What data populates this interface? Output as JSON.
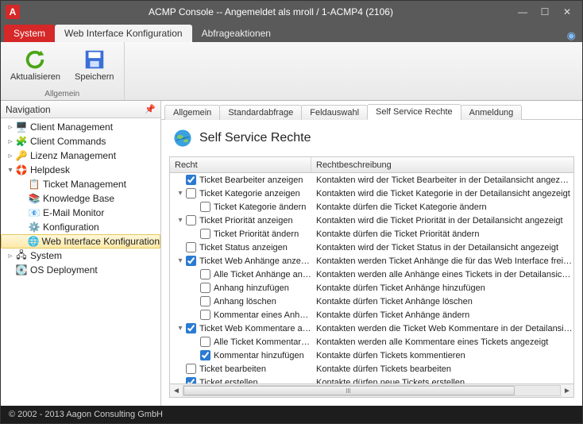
{
  "window": {
    "title": "ACMP Console -- Angemeldet als mroll / 1-ACMP4 (2106)"
  },
  "ribbon_tabs": {
    "system": "System",
    "active": "Web Interface Konfiguration",
    "third": "Abfrageaktionen"
  },
  "ribbon": {
    "refresh": "Aktualisieren",
    "save": "Speichern",
    "group": "Allgemein"
  },
  "nav": {
    "title": "Navigation",
    "items": {
      "client_mgmt": "Client Management",
      "client_cmds": "Client Commands",
      "lizenz_mgmt": "Lizenz Management",
      "helpdesk": "Helpdesk",
      "ticket_mgmt": "Ticket Management",
      "kb": "Knowledge Base",
      "email_mon": "E-Mail Monitor",
      "konfig": "Konfiguration",
      "web_if": "Web Interface Konfiguration",
      "system": "System",
      "os_deploy": "OS Deployment"
    }
  },
  "inner_tabs": {
    "t0": "Allgemein",
    "t1": "Standardabfrage",
    "t2": "Feldauswahl",
    "t3": "Self Service Rechte",
    "t4": "Anmeldung"
  },
  "section_title": "Self Service Rechte",
  "columns": {
    "recht": "Recht",
    "beschr": "Rechtbeschreibung"
  },
  "rows": [
    {
      "depth": 0,
      "twist": "",
      "checked": true,
      "r": "Ticket Bearbeiter anzeigen",
      "d": "Kontakten wird der Ticket Bearbeiter in der Detailansicht angezeigt"
    },
    {
      "depth": 0,
      "twist": "▾",
      "checked": false,
      "r": "Ticket Kategorie anzeigen",
      "d": "Kontakten wird die Ticket Kategorie in der Detailansicht angezeigt"
    },
    {
      "depth": 1,
      "twist": "",
      "checked": false,
      "r": "Ticket Kategorie ändern",
      "d": "Kontakte dürfen die Ticket Kategorie ändern"
    },
    {
      "depth": 0,
      "twist": "▾",
      "checked": false,
      "r": "Ticket Priorität anzeigen",
      "d": "Kontakten wird die Ticket Priorität in der Detailansicht angezeigt"
    },
    {
      "depth": 1,
      "twist": "",
      "checked": false,
      "r": "Ticket Priorität ändern",
      "d": "Kontakte dürfen die Ticket Priorität ändern"
    },
    {
      "depth": 0,
      "twist": "",
      "checked": false,
      "r": "Ticket Status anzeigen",
      "d": "Kontakten wird der Ticket Status in der Detailansicht angezeigt"
    },
    {
      "depth": 0,
      "twist": "▾",
      "checked": true,
      "r": "Ticket Web Anhänge anzeigen",
      "d": "Kontakten werden Ticket Anhänge die für das Web Interface freigeschaltet wu"
    },
    {
      "depth": 1,
      "twist": "",
      "checked": false,
      "r": "Alle Ticket Anhänge anze...",
      "d": "Kontakten werden alle Anhänge eines Tickets in der Detailansicht angezeigt"
    },
    {
      "depth": 1,
      "twist": "",
      "checked": false,
      "r": "Anhang hinzufügen",
      "d": "Kontakte dürfen Ticket Anhänge  hinzufügen"
    },
    {
      "depth": 1,
      "twist": "",
      "checked": false,
      "r": "Anhang löschen",
      "d": "Kontakte dürfen Ticket Anhänge löschen"
    },
    {
      "depth": 1,
      "twist": "",
      "checked": false,
      "r": "Kommentar eines Anhan...",
      "d": "Kontakte dürfen Ticket Anhänge ändern"
    },
    {
      "depth": 0,
      "twist": "▾",
      "checked": true,
      "r": "Ticket Web Kommentare anz...",
      "d": "Kontakten werden die Ticket Web Kommentare in der Detailansicht angezeigt"
    },
    {
      "depth": 1,
      "twist": "",
      "checked": false,
      "r": "Alle Ticket Kommentare a...",
      "d": "Kontakten werden alle Kommentare eines Tickets angezeigt"
    },
    {
      "depth": 1,
      "twist": "",
      "checked": true,
      "r": "Kommentar hinzufügen",
      "d": "Kontakte dürfen Tickets kommentieren"
    },
    {
      "depth": 0,
      "twist": "",
      "checked": false,
      "r": "Ticket bearbeiten",
      "d": "Kontakte dürfen Tickets bearbeiten"
    },
    {
      "depth": 0,
      "twist": "",
      "checked": true,
      "r": "Ticket erstellen",
      "d": "Kontakte dürfen neue Tickets erstellen"
    }
  ],
  "footer": "© 2002 - 2013 Aagon Consulting GmbH"
}
